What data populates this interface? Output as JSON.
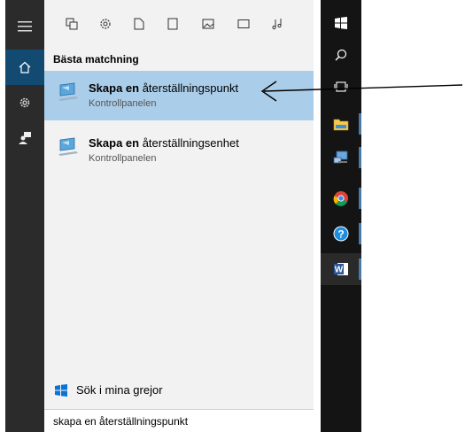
{
  "rail": {
    "items": [
      {
        "name": "hamburger-menu",
        "icon": "hamburger-icon"
      },
      {
        "name": "home",
        "icon": "home-icon",
        "active": true
      },
      {
        "name": "settings",
        "icon": "gear-icon"
      },
      {
        "name": "feedback",
        "icon": "feedback-icon"
      }
    ]
  },
  "filters": [
    {
      "name": "apps",
      "icon": "apps-icon"
    },
    {
      "name": "settings",
      "icon": "gear-icon"
    },
    {
      "name": "documents",
      "icon": "document-icon"
    },
    {
      "name": "folders",
      "icon": "tablet-icon"
    },
    {
      "name": "photos",
      "icon": "photo-icon"
    },
    {
      "name": "videos",
      "icon": "video-icon"
    },
    {
      "name": "music",
      "icon": "music-icon"
    }
  ],
  "section_title": "Bästa matchning",
  "results": [
    {
      "bold": "Skapa en",
      "rest": " återställningspunkt",
      "subtitle": "Kontrollpanelen",
      "selected": true
    },
    {
      "bold": "Skapa en",
      "rest": " återställningsenhet",
      "subtitle": "Kontrollpanelen",
      "selected": false
    }
  ],
  "search_mine_label": "Sök i mina grejor",
  "search": {
    "value": "skapa en återställningspunkt"
  },
  "taskbar": [
    {
      "name": "start",
      "icon": "windows-icon"
    },
    {
      "name": "search",
      "icon": "search-icon"
    },
    {
      "name": "task-view",
      "icon": "task-view-icon"
    },
    {
      "name": "file-explorer",
      "icon": "folder-icon"
    },
    {
      "name": "network",
      "icon": "computer-icon"
    },
    {
      "name": "chrome",
      "icon": "chrome-icon"
    },
    {
      "name": "help",
      "icon": "help-icon"
    },
    {
      "name": "word",
      "icon": "word-icon"
    }
  ],
  "colors": {
    "selected": "#aacde9",
    "rail": "#2b2b2b",
    "rail_active": "#124a72",
    "taskbar": "#141414",
    "panel": "#f2f2f2"
  }
}
